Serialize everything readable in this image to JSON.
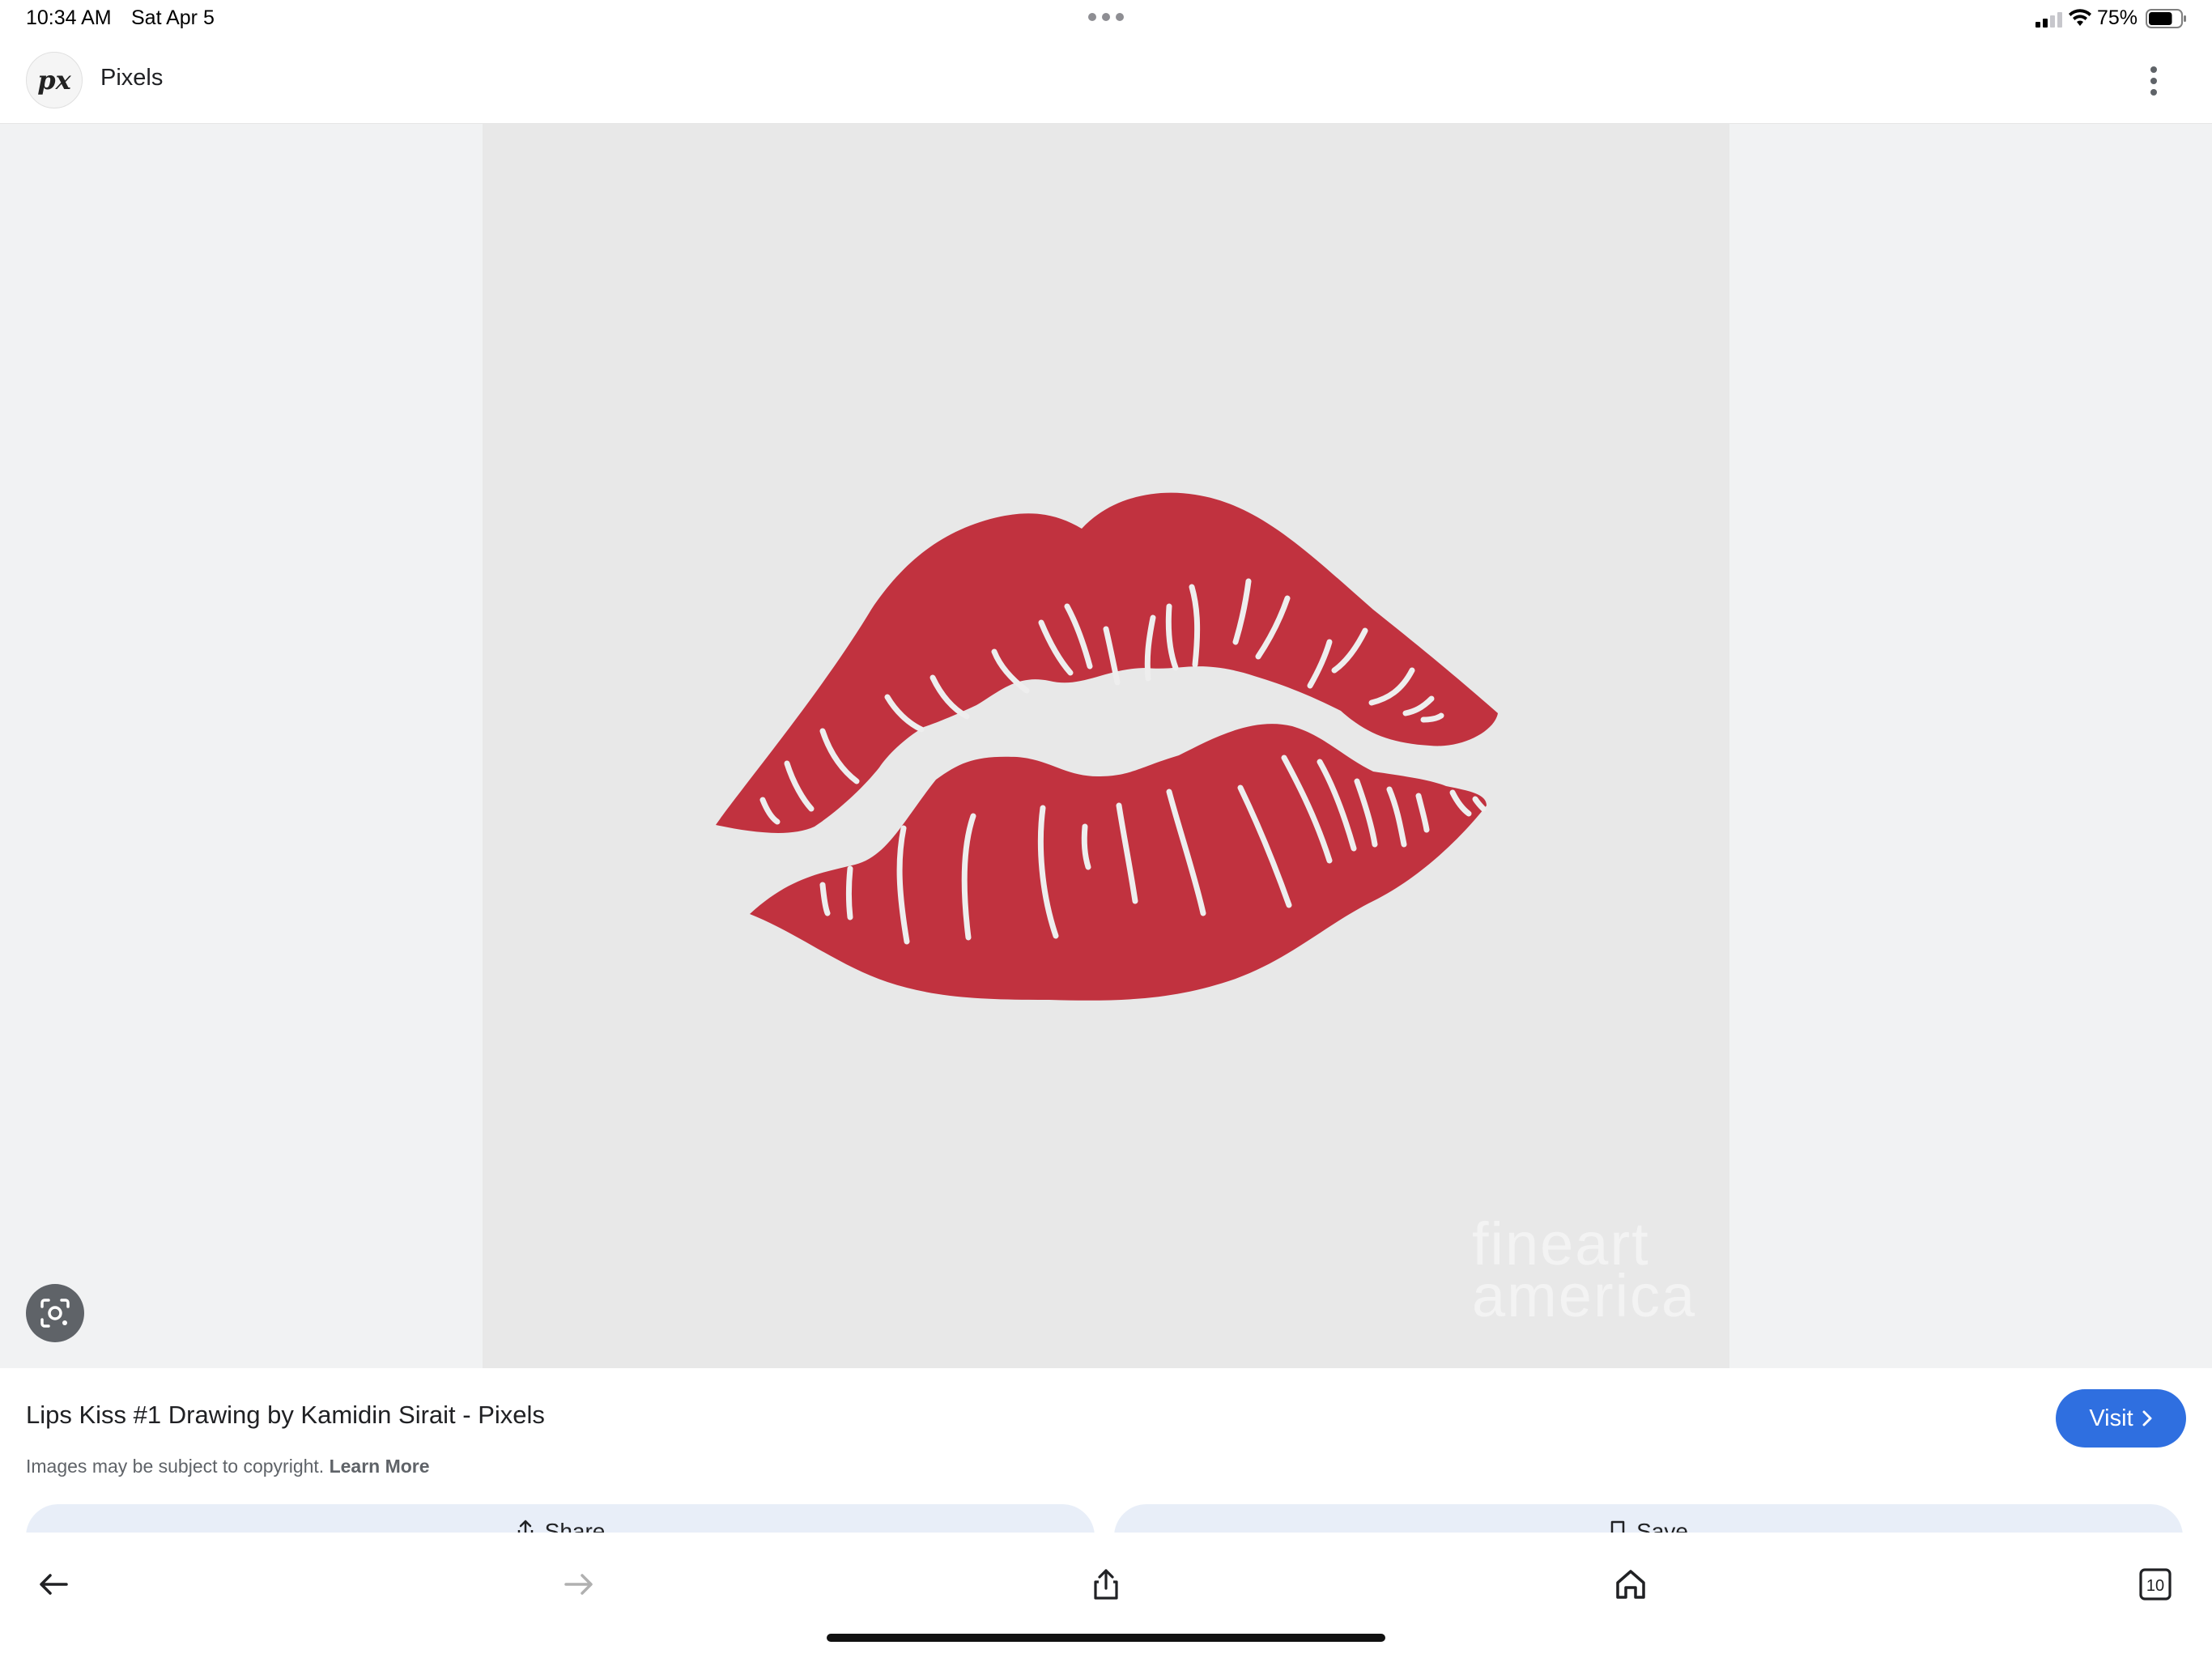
{
  "status_bar": {
    "time": "10:34 AM",
    "date": "Sat Apr 5",
    "battery_percent": "75%",
    "battery_level": 0.75
  },
  "header": {
    "logo_text": "px",
    "site_name": "Pixels"
  },
  "image": {
    "watermark_line1": "fineart",
    "watermark_line2": "america",
    "colors": {
      "lips": "#c1323f",
      "background": "#e8e8e8"
    }
  },
  "result": {
    "title": "Lips Kiss #1 Drawing by Kamidin Sirait - Pixels",
    "visit_label": "Visit",
    "copyright_text": "Images may be subject to copyright.",
    "learn_more": "Learn More"
  },
  "actions": {
    "share_label": "Share",
    "save_label": "Save"
  },
  "toolbar": {
    "tabs_count": "10"
  },
  "icons": [
    "signal-icon",
    "wifi-icon",
    "battery-icon",
    "more-vert-icon",
    "lens-icon",
    "chevron-right-icon",
    "share-icon",
    "bookmark-icon",
    "back-arrow-icon",
    "forward-arrow-icon",
    "home-icon",
    "tabs-icon"
  ],
  "accent_color": "#2f6fe0"
}
